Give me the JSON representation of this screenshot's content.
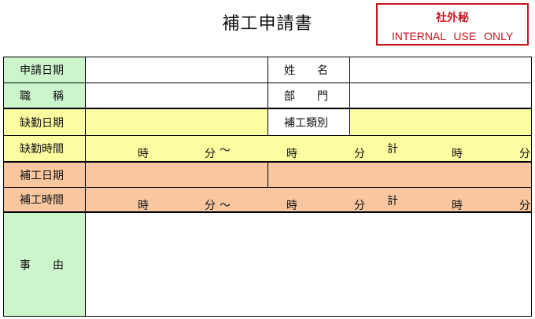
{
  "title": "補工申請書",
  "stamp": {
    "line1": "社外秘",
    "line2": "INTERNAL USE ONLY"
  },
  "form": {
    "application_date_label": "申請日期",
    "name_label": "姓　　名",
    "position_label": "職　　稱",
    "department_label": "部　　門",
    "absence_date_label": "缺勤日期",
    "makeup_type_label": "補工類別",
    "absence_time_label": "缺勤時間",
    "makeup_date_label": "補工日期",
    "makeup_time_label": "補工時間",
    "reason_label": "事　　由",
    "time_row": {
      "hour": "時",
      "minute": "分",
      "tilde": "〜",
      "total": "計"
    }
  }
}
